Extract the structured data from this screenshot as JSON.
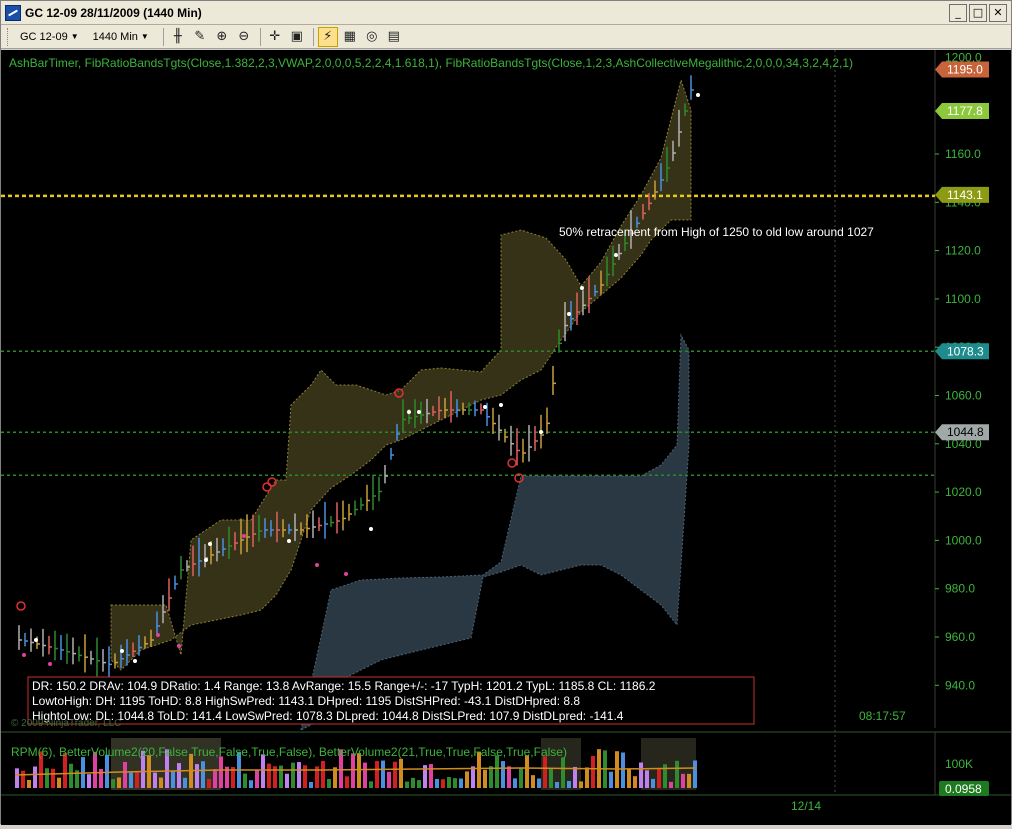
{
  "window": {
    "title": "GC 12-09  28/11/2009 (1440 Min)",
    "buttons": [
      "_",
      "□",
      "✕"
    ]
  },
  "toolbar": {
    "instrument": "GC 12-09",
    "interval": "1440 Min"
  },
  "chart": {
    "indicators_label": "AshBarTimer,  FibRatioBandsTgts(Close,1.382,2,3,VWAP,2,0,0,0,5,2,2,4,1.618,1),  FibRatioBandsTgts(Close,1,2,3,AshCollectiveMegalithic,2,0,0,0,34,3,2,4,2,1)",
    "price_axis": {
      "ticks": [
        {
          "value": 1160,
          "label": "1160.0"
        },
        {
          "value": 1140,
          "label": "1140.0"
        },
        {
          "value": 1120,
          "label": "1120.0"
        },
        {
          "value": 1100,
          "label": "1100.0"
        },
        {
          "value": 1080,
          "label": "1080.0"
        },
        {
          "value": 1060,
          "label": "1060.0"
        },
        {
          "value": 1040,
          "label": "1040.0"
        },
        {
          "value": 1020,
          "label": "1020.0"
        },
        {
          "value": 1000,
          "label": "1000.0"
        },
        {
          "value": 980,
          "label": "980.0"
        },
        {
          "value": 960,
          "label": "960.0"
        },
        {
          "value": 940,
          "label": "940.0"
        }
      ],
      "top_partial_label": "1200.0",
      "markers": [
        {
          "label": "1195.0",
          "value": 1195.0,
          "color": "#c8643c"
        },
        {
          "label": "1177.8",
          "value": 1177.8,
          "color": "#8cc83c"
        },
        {
          "label": "1143.1",
          "value": 1143.1,
          "color": "#8c9a14"
        },
        {
          "label": "1078.3",
          "value": 1078.3,
          "color": "#1e8c8c"
        },
        {
          "label": "1044.8",
          "value": 1044.8,
          "color": "#a0a8a8"
        }
      ]
    },
    "annotation": "50% retracement from High of 1250 to old low around 1027",
    "info_box": {
      "row1": "DR:  150.2 DRAv:  104.9  DRatio:  1.4  Range:  13.8  AvRange:  15.5  Range+/-:  -17  TypH:  1201.2  TypL:  1185.8  CL:  1186.2",
      "row2": "LowtoHigh:     DH:  1195  ToHD:  8.8  HighSwPred:  1143.1  DHpred:  1195  DistSHPred:  -43.1    DistDHpred:  8.8",
      "row3": "HightoLow:     DL:   1044.8  ToLD:  141.4  LowSwPred:   1078.3  DLpred:    1044.8  DistSLPred:  107.9   DistDLpred:  -141.4"
    },
    "copyright": "© 2009 NinjaTrader, LLC",
    "timer": "08:17:57",
    "volume_panel": {
      "label": "RPM(6),  BetterVolume2(20,False,True,False,True,False),  BetterVolume2(21,True,True,False,True,False)",
      "axis_label": "100K",
      "marker": "0.0958"
    },
    "date_axis": {
      "label": "12/14"
    }
  }
}
